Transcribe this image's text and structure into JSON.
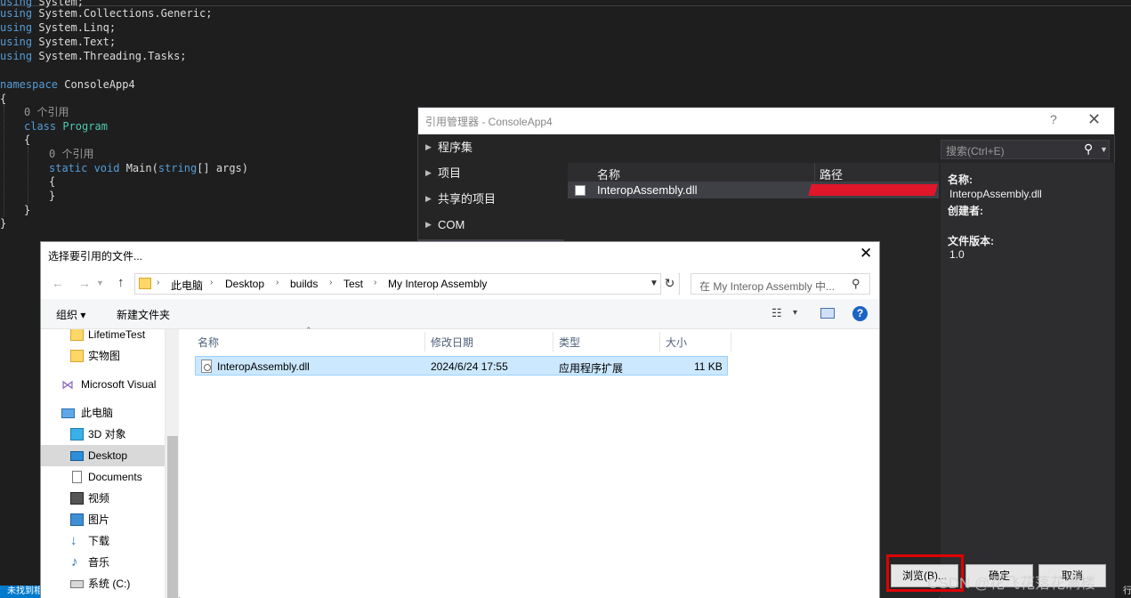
{
  "editor": {
    "lines": [
      {
        "p1": "using ",
        "k": "System;",
        "p2": ""
      },
      {
        "p1": "using ",
        "k": "System.Collections.Generic;",
        "p2": ""
      },
      {
        "p1": "using ",
        "k": "System.Linq;",
        "p2": ""
      },
      {
        "p1": "using ",
        "k": "System.Text;",
        "p2": ""
      },
      {
        "p1": "using ",
        "k": "System.Threading.Tasks;",
        "p2": ""
      }
    ],
    "namespace_kw": "namespace",
    "namespace_name": " ConsoleApp4",
    "open_brace": "{",
    "ref_count_1": "0 个引用",
    "class_kw": "class",
    "class_name": " Program",
    "brace_2": "{",
    "ref_count_2": "0 个引用",
    "method_static": "static",
    "method_void": " void",
    "method_name": " Main(",
    "method_type": "string",
    "method_args": "[] args)",
    "brace_3": "{",
    "brace_4": "}",
    "brace_5": "}",
    "brace_6": "}",
    "status_left": "未找到相",
    "status_right": "行"
  },
  "ref_manager": {
    "title": "引用管理器 - ConsoleApp4",
    "help": "?",
    "close": "✕",
    "nav": [
      "程序集",
      "项目",
      "共享的项目",
      "COM"
    ],
    "search_placeholder": "搜索(Ctrl+E)",
    "columns": {
      "name": "名称",
      "path": "路径"
    },
    "row": {
      "name": "InteropAssembly.dll"
    },
    "detail": {
      "name_label": "名称:",
      "name_value": "InteropAssembly.dll",
      "creator_label": "创建者:",
      "version_label": "文件版本:",
      "version_value": "1.0"
    },
    "buttons": {
      "browse": "浏览(B)...",
      "ok": "确定",
      "cancel": "取消"
    },
    "watermark": "CSDN @花飞花落花满楼"
  },
  "file_dialog": {
    "title": "选择要引用的文件...",
    "close": "✕",
    "breadcrumb": [
      "此电脑",
      "Desktop",
      "builds",
      "Test",
      "My Interop Assembly"
    ],
    "search_placeholder": "在 My Interop Assembly 中...",
    "toolbar": {
      "organize": "组织 ▾",
      "new_folder": "新建文件夹",
      "view": "▾"
    },
    "tree": [
      {
        "label": "LifetimeTest",
        "icon": "folder-icon"
      },
      {
        "label": "实物图",
        "icon": "folder-icon"
      },
      {
        "label": "Microsoft Visual",
        "icon": "visual-studio-icon"
      },
      {
        "label": "此电脑",
        "icon": "computer-icon"
      },
      {
        "label": "3D 对象",
        "icon": "cube-icon"
      },
      {
        "label": "Desktop",
        "icon": "desktop-icon"
      },
      {
        "label": "Documents",
        "icon": "document-icon"
      },
      {
        "label": "视频",
        "icon": "video-icon"
      },
      {
        "label": "图片",
        "icon": "picture-icon"
      },
      {
        "label": "下载",
        "icon": "download-icon"
      },
      {
        "label": "音乐",
        "icon": "music-icon"
      },
      {
        "label": "系统 (C:)",
        "icon": "drive-icon"
      }
    ],
    "columns": {
      "name": "名称",
      "modified": "修改日期",
      "type": "类型",
      "size": "大小"
    },
    "files": [
      {
        "name": "InteropAssembly.dll",
        "modified": "2024/6/24 17:55",
        "type": "应用程序扩展",
        "size": "11 KB"
      }
    ]
  }
}
